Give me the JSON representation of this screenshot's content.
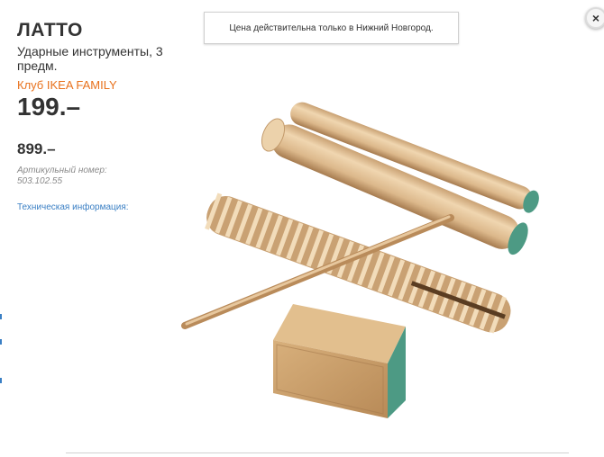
{
  "product": {
    "name": "ЛАТТО",
    "description": "Ударные инструменты, 3 предм.",
    "family_label": "Клуб IKEA FAMILY",
    "family_price": "199.–",
    "regular_price": "899.–",
    "article": "Артикульный номер: 503.102.55",
    "tech_info_link": "Техническая информация:"
  },
  "notice": "Цена действительна только в Нижний Новгород.",
  "close_icon": "×",
  "colors": {
    "family_orange": "#e8711c",
    "link_blue": "#3a7fc4",
    "wood": "#d9b487",
    "accent_green": "#4d9a84"
  },
  "icons": [
    "close-icon"
  ]
}
